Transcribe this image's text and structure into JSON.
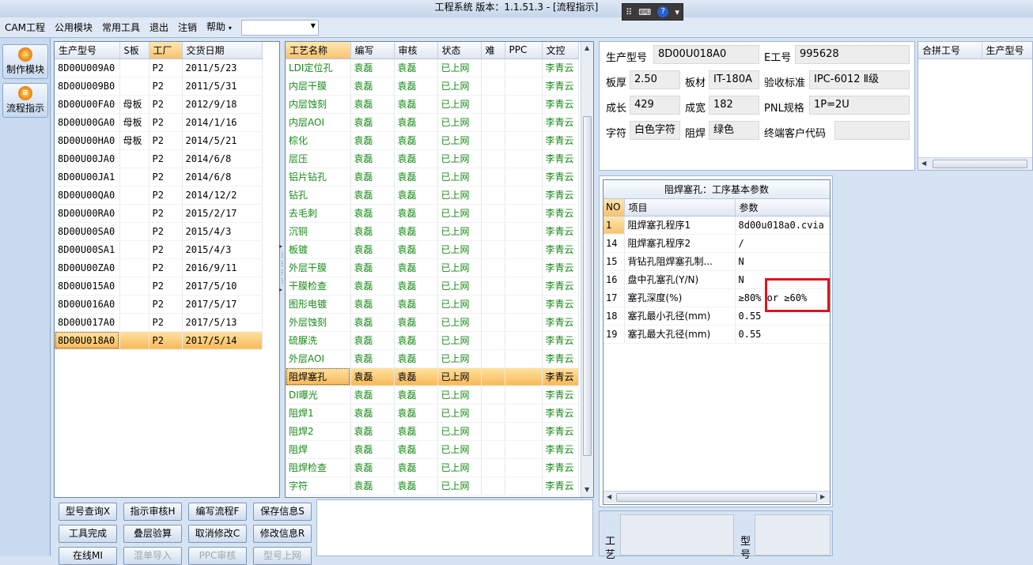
{
  "window": {
    "title": "工程系统  版本：1.1.51.3 - [流程指示]"
  },
  "menubar": {
    "items": [
      "CAM工程",
      "公用模块",
      "常用工具",
      "退出",
      "注销",
      "帮助"
    ],
    "help_arrow": "▾",
    "combo_value": ""
  },
  "modules": [
    {
      "label": "制作模块",
      "icon": "flame-icon"
    },
    {
      "label": "流程指示",
      "icon": "flow-icon"
    }
  ],
  "parts_grid": {
    "columns": [
      "生产型号",
      "S板",
      "工厂",
      "交货日期"
    ],
    "rows": [
      [
        "8D00U009A0",
        "",
        "P2",
        "2011/5/23"
      ],
      [
        "8D00U009B0",
        "",
        "P2",
        "2011/5/31"
      ],
      [
        "8D00U00FA0",
        "母板",
        "P2",
        "2012/9/18"
      ],
      [
        "8D00U00GA0",
        "母板",
        "P2",
        "2014/1/16"
      ],
      [
        "8D00U00HA0",
        "母板",
        "P2",
        "2014/5/21"
      ],
      [
        "8D00U00JA0",
        "",
        "P2",
        "2014/6/8"
      ],
      [
        "8D00U00JA1",
        "",
        "P2",
        "2014/6/8"
      ],
      [
        "8D00U00QA0",
        "",
        "P2",
        "2014/12/2"
      ],
      [
        "8D00U00RA0",
        "",
        "P2",
        "2015/2/17"
      ],
      [
        "8D00U00SA0",
        "",
        "P2",
        "2015/4/3"
      ],
      [
        "8D00U00SA1",
        "",
        "P2",
        "2015/4/3"
      ],
      [
        "8D00U00ZA0",
        "",
        "P2",
        "2016/9/11"
      ],
      [
        "8D00U015A0",
        "",
        "P2",
        "2017/5/10"
      ],
      [
        "8D00U016A0",
        "",
        "P2",
        "2017/5/17"
      ],
      [
        "8D00U017A0",
        "",
        "P2",
        "2017/5/13"
      ],
      [
        "8D00U018A0",
        "",
        "P2",
        "2017/5/14"
      ]
    ],
    "selected_index": 15
  },
  "process_grid": {
    "columns": [
      "工艺名称",
      "编写",
      "审核",
      "状态",
      "难",
      "PPC",
      "文控"
    ],
    "rows": [
      [
        "LDI定位孔",
        "袁磊",
        "袁磊",
        "已上网",
        "",
        "",
        "李青云"
      ],
      [
        "内层干膜",
        "袁磊",
        "袁磊",
        "已上网",
        "",
        "",
        "李青云"
      ],
      [
        "内层蚀刻",
        "袁磊",
        "袁磊",
        "已上网",
        "",
        "",
        "李青云"
      ],
      [
        "内层AOI",
        "袁磊",
        "袁磊",
        "已上网",
        "",
        "",
        "李青云"
      ],
      [
        "棕化",
        "袁磊",
        "袁磊",
        "已上网",
        "",
        "",
        "李青云"
      ],
      [
        "层压",
        "袁磊",
        "袁磊",
        "已上网",
        "",
        "",
        "李青云"
      ],
      [
        "铝片钻孔",
        "袁磊",
        "袁磊",
        "已上网",
        "",
        "",
        "李青云"
      ],
      [
        "钻孔",
        "袁磊",
        "袁磊",
        "已上网",
        "",
        "",
        "李青云"
      ],
      [
        "去毛刺",
        "袁磊",
        "袁磊",
        "已上网",
        "",
        "",
        "李青云"
      ],
      [
        "沉铜",
        "袁磊",
        "袁磊",
        "已上网",
        "",
        "",
        "李青云"
      ],
      [
        "板镀",
        "袁磊",
        "袁磊",
        "已上网",
        "",
        "",
        "李青云"
      ],
      [
        "外层干膜",
        "袁磊",
        "袁磊",
        "已上网",
        "",
        "",
        "李青云"
      ],
      [
        "干膜检查",
        "袁磊",
        "袁磊",
        "已上网",
        "",
        "",
        "李青云"
      ],
      [
        "图形电镀",
        "袁磊",
        "袁磊",
        "已上网",
        "",
        "",
        "李青云"
      ],
      [
        "外层蚀刻",
        "袁磊",
        "袁磊",
        "已上网",
        "",
        "",
        "李青云"
      ],
      [
        "硫脲洗",
        "袁磊",
        "袁磊",
        "已上网",
        "",
        "",
        "李青云"
      ],
      [
        "外层AOI",
        "袁磊",
        "袁磊",
        "已上网",
        "",
        "",
        "李青云"
      ],
      [
        "阻焊塞孔",
        "袁磊",
        "袁磊",
        "已上网",
        "",
        "",
        "李青云"
      ],
      [
        "DI曝光",
        "袁磊",
        "袁磊",
        "已上网",
        "",
        "",
        "李青云"
      ],
      [
        "阻焊1",
        "袁磊",
        "袁磊",
        "已上网",
        "",
        "",
        "李青云"
      ],
      [
        "阻焊2",
        "袁磊",
        "袁磊",
        "已上网",
        "",
        "",
        "李青云"
      ],
      [
        "阻焊",
        "袁磊",
        "袁磊",
        "已上网",
        "",
        "",
        "李青云"
      ],
      [
        "阻焊检查",
        "袁磊",
        "袁磊",
        "已上网",
        "",
        "",
        "李青云"
      ],
      [
        "字符",
        "袁磊",
        "袁磊",
        "已上网",
        "",
        "",
        "李青云"
      ]
    ],
    "selected_index": 17
  },
  "info": {
    "model_label": "生产型号",
    "model_value": "8D00U018A0",
    "e_label": "E工号",
    "e_value": "995628",
    "thickness_label": "板厚",
    "thickness_value": "2.50",
    "material_label": "板材",
    "material_value": "IT-180A",
    "standard_label": "验收标准",
    "standard_value": "IPC-6012 Ⅱ级",
    "length_label": "成长",
    "length_value": "429",
    "width_label": "成宽",
    "width_value": "182",
    "pnl_label": "PNL规格",
    "pnl_value": "1P=2U",
    "char_label": "字符",
    "char_value": "白色字符",
    "mask_label": "阻焊",
    "mask_value": "绿色",
    "customer_label": "终端客户代码",
    "customer_value": ""
  },
  "merge_grid": {
    "columns": [
      "合拼工号",
      "生产型号"
    ]
  },
  "params": {
    "title": "阻焊塞孔：工序基本参数",
    "columns": [
      "NO",
      "项目",
      "参数"
    ],
    "rows": [
      [
        "1",
        "阻焊塞孔程序1",
        "8d00u018a0.cvia"
      ],
      [
        "14",
        "阻焊塞孔程序2",
        "/"
      ],
      [
        "15",
        "背钻孔阻焊塞孔制...",
        "N"
      ],
      [
        "16",
        "盘中孔塞孔(Y/N)",
        "N"
      ],
      [
        "17",
        "塞孔深度(%)",
        "≥80% or ≥60%"
      ],
      [
        "18",
        "塞孔最小孔径(mm)",
        "0.55"
      ],
      [
        "19",
        "塞孔最大孔径(mm)",
        "0.55"
      ]
    ]
  },
  "buttons": [
    [
      "型号查询X",
      "指示审核H",
      "编写流程F",
      "保存信息S"
    ],
    [
      "工具完成",
      "叠层验算",
      "取消修改C",
      "修改信息R"
    ],
    [
      "在线MI",
      "混单导入",
      "PPC审核",
      "型号上网"
    ]
  ],
  "bottom_labels": {
    "left": "工艺",
    "right": "型号"
  },
  "colors": {
    "green_text": "#188a18",
    "selection": "#f7b85a",
    "highlight_box": "#e0141e"
  }
}
